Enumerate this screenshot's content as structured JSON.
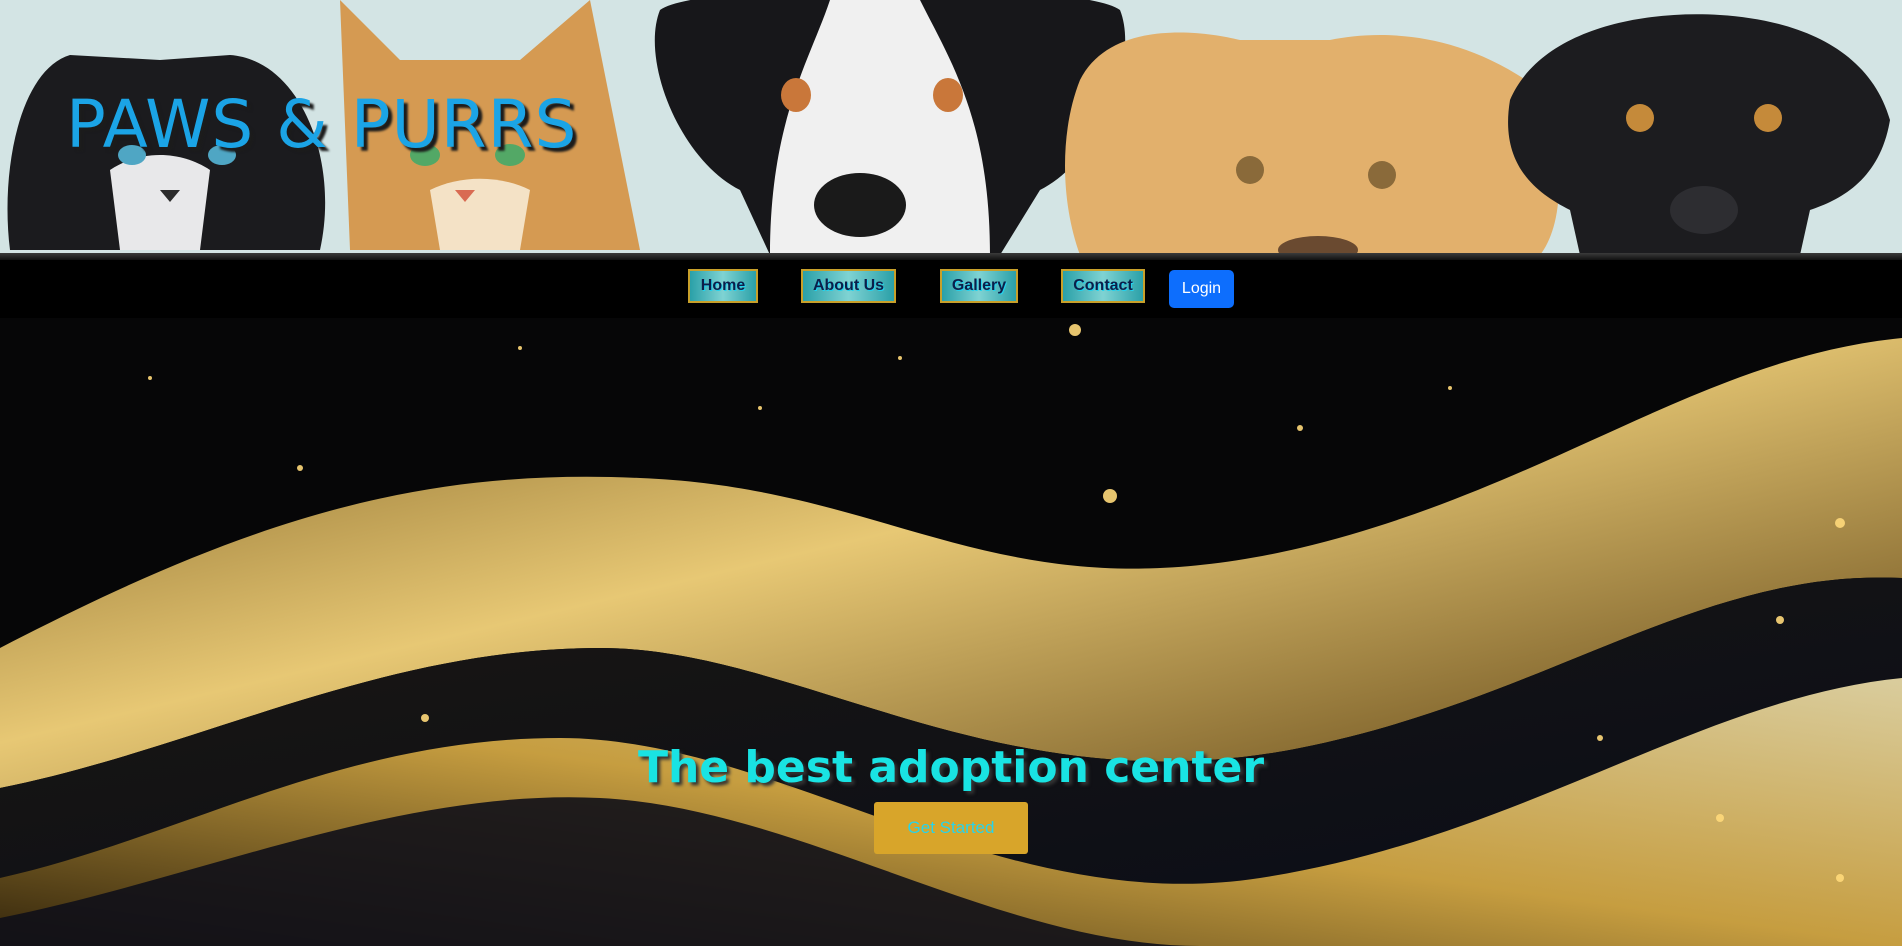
{
  "header": {
    "site_title": "PAWS & PURRS",
    "banner_image": "cats-and-dogs-peeking-over-ledge"
  },
  "nav": {
    "links": [
      {
        "label": "Home"
      },
      {
        "label": "About Us"
      },
      {
        "label": "Gallery"
      },
      {
        "label": "Contact"
      }
    ],
    "login_label": "Login"
  },
  "hero": {
    "background_image": "golden-glitter-waves-on-black",
    "heading": "The best adoption center",
    "cta_label": "Get Started"
  },
  "colors": {
    "title_blue": "#1ba4e6",
    "heading_cyan": "#19e3e3",
    "login_blue": "#0d6efd",
    "cta_gold": "#d8a52a",
    "nav_border_gold": "#c8a02a"
  }
}
